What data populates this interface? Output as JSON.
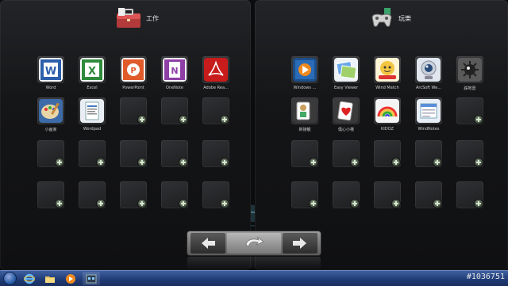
{
  "left_panel": {
    "title": "工作",
    "apps": [
      {
        "label": "Word",
        "icon": "word-icon"
      },
      {
        "label": "Excel",
        "icon": "excel-icon"
      },
      {
        "label": "PowerPoint",
        "icon": "powerpoint-icon"
      },
      {
        "label": "OneNote",
        "icon": "onenote-icon"
      },
      {
        "label": "Adobe Rea...",
        "icon": "adobe-reader-icon"
      },
      {
        "label": "小画家",
        "icon": "paint-icon"
      },
      {
        "label": "Wordpad",
        "icon": "wordpad-icon"
      }
    ],
    "empty_slots": 13
  },
  "right_panel": {
    "title": "玩樂",
    "apps": [
      {
        "label": "Windows ...",
        "icon": "media-player-icon"
      },
      {
        "label": "Easy Viewer",
        "icon": "photo-viewer-icon"
      },
      {
        "label": "Wind Match",
        "icon": "wind-match-icon"
      },
      {
        "label": "ArcSoft We...",
        "icon": "webcam-icon"
      },
      {
        "label": "踩地雷",
        "icon": "minesweeper-icon"
      },
      {
        "label": "新接龍",
        "icon": "solitaire-icon"
      },
      {
        "label": "傷心小棧",
        "icon": "hearts-icon"
      },
      {
        "label": "KIDOZ",
        "icon": "kidoz-icon"
      },
      {
        "label": "WindNotes",
        "icon": "windnotes-icon"
      }
    ],
    "empty_slots": 11
  },
  "navigation": {
    "prev": "arrow-left-icon",
    "home": "rotate-back-icon",
    "next": "arrow-right-icon"
  },
  "taskbar": {
    "items": [
      "start-orb-icon",
      "internet-explorer-icon",
      "folder-icon",
      "media-player-icon",
      "app-window-icon"
    ]
  },
  "watermark": "#1036751"
}
